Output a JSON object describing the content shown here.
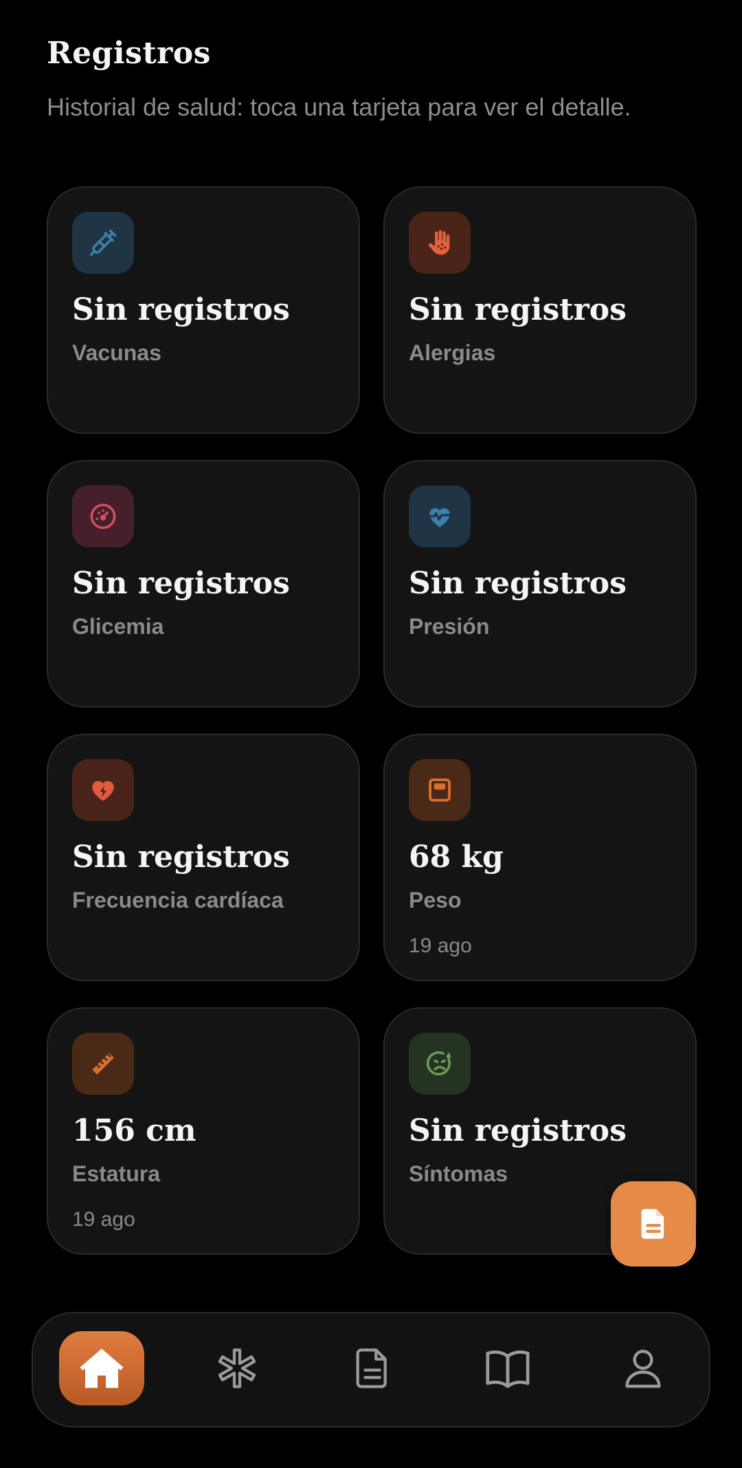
{
  "header": {
    "title": "Registros",
    "subtitle": "Historial de salud: toca una tarjeta para ver el detalle."
  },
  "cards": [
    {
      "id": "vacunas",
      "value": "Sin registros",
      "label": "Vacunas",
      "date": "",
      "icon": "syringe-icon",
      "icon_bg": "#1f3444",
      "icon_color": "#3e7fab"
    },
    {
      "id": "alergias",
      "value": "Sin registros",
      "label": "Alergias",
      "date": "",
      "icon": "hand-dots-icon",
      "icon_bg": "#4a2418",
      "icon_color": "#e0623a"
    },
    {
      "id": "glicemia",
      "value": "Sin registros",
      "label": "Glicemia",
      "date": "",
      "icon": "gauge-icon",
      "icon_bg": "#45202a",
      "icon_color": "#d1505f"
    },
    {
      "id": "presion",
      "value": "Sin registros",
      "label": "Presión",
      "date": "",
      "icon": "heart-pulse-icon",
      "icon_bg": "#1f3444",
      "icon_color": "#3e7fab"
    },
    {
      "id": "frecuencia",
      "value": "Sin registros",
      "label": "Frecuencia cardíaca",
      "date": "",
      "icon": "heart-bolt-icon",
      "icon_bg": "#4a2418",
      "icon_color": "#e25b3c"
    },
    {
      "id": "peso",
      "value": "68 kg",
      "label": "Peso",
      "date": "19 ago",
      "icon": "weight-scale-icon",
      "icon_bg": "#4a2a17",
      "icon_color": "#d7702e"
    },
    {
      "id": "estatura",
      "value": "156 cm",
      "label": "Estatura",
      "date": "19 ago",
      "icon": "ruler-icon",
      "icon_bg": "#4a2a17",
      "icon_color": "#d7702e"
    },
    {
      "id": "sintomas",
      "value": "Sin registros",
      "label": "Síntomas",
      "date": "",
      "icon": "sick-face-icon",
      "icon_bg": "#243322",
      "icon_color": "#6e9a5c"
    }
  ],
  "fab": {
    "icon": "document-icon",
    "color": "#e68a48"
  },
  "nav": {
    "items": [
      {
        "id": "home",
        "icon": "home-icon",
        "active": true
      },
      {
        "id": "medical",
        "icon": "asterisk-icon",
        "active": false
      },
      {
        "id": "records",
        "icon": "document-icon",
        "active": false
      },
      {
        "id": "library",
        "icon": "book-icon",
        "active": false
      },
      {
        "id": "profile",
        "icon": "user-icon",
        "active": false
      }
    ]
  }
}
